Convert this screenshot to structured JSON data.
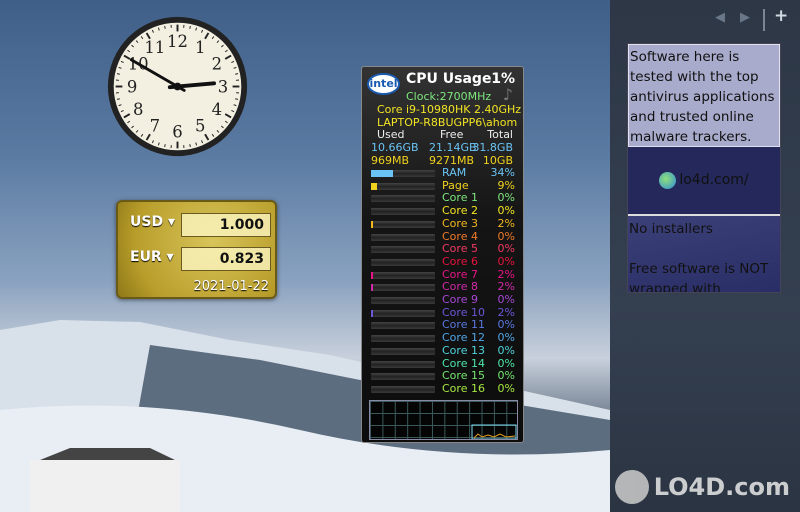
{
  "clock": {
    "hour": 2,
    "minute": 50,
    "numerals": [
      "12",
      "1",
      "2",
      "3",
      "4",
      "5",
      "6",
      "7",
      "8",
      "9",
      "10",
      "11"
    ]
  },
  "currency": {
    "from_code": "USD",
    "from_value": "1.000",
    "to_code": "EUR",
    "to_value": "0.823",
    "date": "2021-01-22"
  },
  "cpu": {
    "logo": "intel",
    "title": "CPU Usage",
    "total": "1%",
    "clock": "Clock:2700MHz",
    "model": "Core i9-10980HK 2.40GHz",
    "host": "LAPTOP-R8BUGPP6\\ahom",
    "headers": [
      "Used",
      "Free",
      "Total"
    ],
    "ram_row": [
      "10.66GB",
      "21.14GB",
      "31.8GB"
    ],
    "page_row": [
      "969MB",
      "9271MB",
      "10GB"
    ],
    "rows": [
      {
        "name": "RAM",
        "pct": "34%",
        "value": 34,
        "color": "#6ac4f5"
      },
      {
        "name": "Page",
        "pct": "9%",
        "value": 9,
        "color": "#f2d21e"
      },
      {
        "name": "Core 1",
        "pct": "0%",
        "value": 0,
        "color": "#7de87d"
      },
      {
        "name": "Core 2",
        "pct": "0%",
        "value": 0,
        "color": "#f2e424"
      },
      {
        "name": "Core 3",
        "pct": "2%",
        "value": 2,
        "color": "#f2b81e"
      },
      {
        "name": "Core 4",
        "pct": "0%",
        "value": 0,
        "color": "#f07a2a"
      },
      {
        "name": "Core 5",
        "pct": "0%",
        "value": 0,
        "color": "#f23a64"
      },
      {
        "name": "Core 6",
        "pct": "0%",
        "value": 0,
        "color": "#e8123e"
      },
      {
        "name": "Core 7",
        "pct": "2%",
        "value": 2,
        "color": "#e81488"
      },
      {
        "name": "Core 8",
        "pct": "2%",
        "value": 2,
        "color": "#d02aa8"
      },
      {
        "name": "Core 9",
        "pct": "0%",
        "value": 0,
        "color": "#a848d8"
      },
      {
        "name": "Core 10",
        "pct": "2%",
        "value": 2,
        "color": "#6a58d8"
      },
      {
        "name": "Core 11",
        "pct": "0%",
        "value": 0,
        "color": "#5a78e0"
      },
      {
        "name": "Core 12",
        "pct": "0%",
        "value": 0,
        "color": "#52a6e6"
      },
      {
        "name": "Core 13",
        "pct": "0%",
        "value": 0,
        "color": "#4ed4dc"
      },
      {
        "name": "Core 14",
        "pct": "0%",
        "value": 0,
        "color": "#4ee6a8"
      },
      {
        "name": "Core 15",
        "pct": "0%",
        "value": 0,
        "color": "#74e66e"
      },
      {
        "name": "Core 16",
        "pct": "0%",
        "value": 0,
        "color": "#a6e642"
      }
    ]
  },
  "sidebar": {
    "note": "Software here is tested with the top antivirus applications and trusted online malware trackers.",
    "link": "lo4d.com/",
    "installers": "No installers",
    "free": "Free software is NOT wrapped with"
  },
  "watermark": "LO4D.com"
}
